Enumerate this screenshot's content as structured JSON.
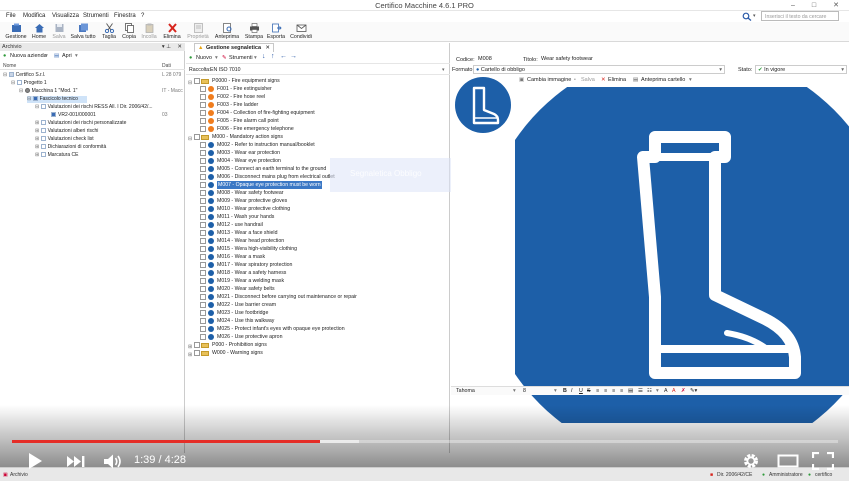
{
  "window": {
    "title": "Certifico Macchine 4.6.1 PRO",
    "minimize": "–",
    "maximize": "□",
    "close": "✕"
  },
  "menu": [
    "File",
    "Modifica",
    "Visualizza",
    "Strumenti",
    "Finestra",
    "?"
  ],
  "search": {
    "placeholder": "Inserisci il testo da cercare"
  },
  "ribbon": [
    {
      "label": "Gestione",
      "icon": "gestione-icon",
      "disabled": false
    },
    {
      "label": "Home",
      "icon": "home-icon",
      "disabled": false
    },
    {
      "label": "Salva",
      "icon": "save-icon",
      "disabled": true
    },
    {
      "label": "Salva tutto",
      "icon": "save-all-icon",
      "disabled": false
    },
    {
      "label": "Taglia",
      "icon": "scissors-icon",
      "disabled": false
    },
    {
      "label": "Copia",
      "icon": "copy-icon",
      "disabled": false
    },
    {
      "label": "Incolla",
      "icon": "paste-icon",
      "disabled": true
    },
    {
      "label": "Elimina",
      "icon": "delete-icon",
      "disabled": false
    },
    {
      "label": "Proprietà",
      "icon": "properties-icon",
      "disabled": true
    },
    {
      "label": "Anteprima",
      "icon": "preview-icon",
      "disabled": false
    },
    {
      "label": "Stampa",
      "icon": "print-icon",
      "disabled": false
    },
    {
      "label": "Esporta",
      "icon": "export-icon",
      "disabled": false
    },
    {
      "label": "Condividi",
      "icon": "share-icon",
      "disabled": false
    }
  ],
  "left_panel": {
    "title": "Archivio",
    "toolbar": {
      "new": "Nuova azienda",
      "open": "Apri"
    },
    "columns": {
      "name": "Nome",
      "date": "Dati"
    },
    "tree": [
      {
        "label": "Certifico S.r.l.",
        "date": "L 28 079",
        "selected": false
      },
      {
        "label": "Progetto 1",
        "date": "",
        "selected": false
      },
      {
        "label": "Macchina 1 \"Mod. 1\"",
        "date": "IT - Macc",
        "selected": false
      },
      {
        "label": "Fascicolo tecnico",
        "date": "",
        "selected": true
      },
      {
        "label": "Valutazioni dei rischi RESS All. I Dir. 2006/42/...",
        "date": "",
        "selected": false
      },
      {
        "label": "VR2-001/000001",
        "date": "03",
        "selected": false
      },
      {
        "label": "Valutazioni dei rischi personalizzate",
        "date": "",
        "selected": false
      },
      {
        "label": "Valutazioni alberi rischi",
        "date": "",
        "selected": false
      },
      {
        "label": "Valutazioni check list",
        "date": "",
        "selected": false
      },
      {
        "label": "Dichiarazioni di conformità",
        "date": "",
        "selected": false
      },
      {
        "label": "Marcatura CE",
        "date": "",
        "selected": false
      }
    ]
  },
  "middle_panel": {
    "tab": "Gestione segnaletica",
    "toolbar": {
      "new": "Nuovo",
      "tools": "Strumenti"
    },
    "raccolta_label": "Raccolta:",
    "raccolta_value": "EN ISO 7010",
    "groups": [
      {
        "code": "P0000 - Fire equipment signs",
        "color": "r",
        "items": [
          {
            "code": "F001 - Fire extinguisher",
            "color": "o"
          },
          {
            "code": "F002 - Fire hose reel",
            "color": "o"
          },
          {
            "code": "F003 - Fire ladder",
            "color": "o"
          },
          {
            "code": "F004 - Collection of fire-fighting equipment",
            "color": "o"
          },
          {
            "code": "F005 - Fire alarm call point",
            "color": "o"
          },
          {
            "code": "F006 - Fire emergency telephone",
            "color": "o"
          }
        ]
      },
      {
        "code": "M000 - Mandatory action signs",
        "color": "b",
        "items": [
          {
            "code": "M002 - Refer to instruction manual/booklet",
            "color": "b"
          },
          {
            "code": "M003 - Wear ear protection",
            "color": "b"
          },
          {
            "code": "M004 - Wear eye protection",
            "color": "b"
          },
          {
            "code": "M005 - Connect an earth terminal to the ground",
            "color": "b"
          },
          {
            "code": "M006 - Disconnect mains plug from electrical outlet",
            "color": "b"
          },
          {
            "code": "M007 - Opaque eye protection must be worn",
            "color": "b",
            "selected": true
          },
          {
            "code": "M008 - Wear safety footwear",
            "color": "b"
          },
          {
            "code": "M009 - Wear protective gloves",
            "color": "b"
          },
          {
            "code": "M010 - Wear protective clothing",
            "color": "b"
          },
          {
            "code": "M011 - Wash your hands",
            "color": "b"
          },
          {
            "code": "M012 - use handrail",
            "color": "b"
          },
          {
            "code": "M013 - Wear a face shield",
            "color": "b"
          },
          {
            "code": "M014 - Wear head protection",
            "color": "b"
          },
          {
            "code": "M015 - Wera high-visibility clothing",
            "color": "b"
          },
          {
            "code": "M016 - Wear a mask",
            "color": "b"
          },
          {
            "code": "M017 - Wear spiratory protection",
            "color": "b"
          },
          {
            "code": "M018 - Wear a safety harness",
            "color": "b"
          },
          {
            "code": "M019 - Wear a welding mask",
            "color": "b"
          },
          {
            "code": "M020 - Wear safety belts",
            "color": "b"
          },
          {
            "code": "M021 - Disconnect before carrying out maintenance or repair",
            "color": "b"
          },
          {
            "code": "M022 - Use barrier cream",
            "color": "b"
          },
          {
            "code": "M023 - Use footbridge",
            "color": "b"
          },
          {
            "code": "M024 - Use this walkway",
            "color": "b"
          },
          {
            "code": "M025 - Protect infant's eyes with opaque eye protection",
            "color": "b"
          },
          {
            "code": "M026 - Use protective apron",
            "color": "b"
          }
        ]
      },
      {
        "code": "P000 - Prohibition signs",
        "color": "r",
        "items": []
      },
      {
        "code": "W000 - Warning signs",
        "color": "y",
        "items": []
      }
    ],
    "drag_overlay": "Segnaletica Obbligo"
  },
  "right_panel": {
    "codice_label": "Codice:",
    "codice_value": "M008",
    "titolo_label": "Titolo:",
    "titolo_value": "Wear safety footwear",
    "formato_label": "Formato:",
    "formato_value": "Cartello di obbligo",
    "stato_label": "Stato:",
    "stato_value": "In vigore",
    "image_toolbar": {
      "change": "Cambia immagine",
      "save": "Salva",
      "delete": "Elimina",
      "preview": "Anteprima cartello"
    },
    "format_bar": {
      "font": "Tahoma",
      "size": "8",
      "bold": "B",
      "italic": "I",
      "underline": "U",
      "strike": "S"
    },
    "sign_color": "#1d5fa8"
  },
  "status_bar": {
    "archive": "Archivio",
    "dir": "Dir. 2006/42/CE",
    "admin": "Amministratore",
    "user": "certifico"
  },
  "video": {
    "current": "1:39",
    "separator": "/",
    "duration": "4:28",
    "progress": 0.373,
    "buffered": 0.42
  }
}
